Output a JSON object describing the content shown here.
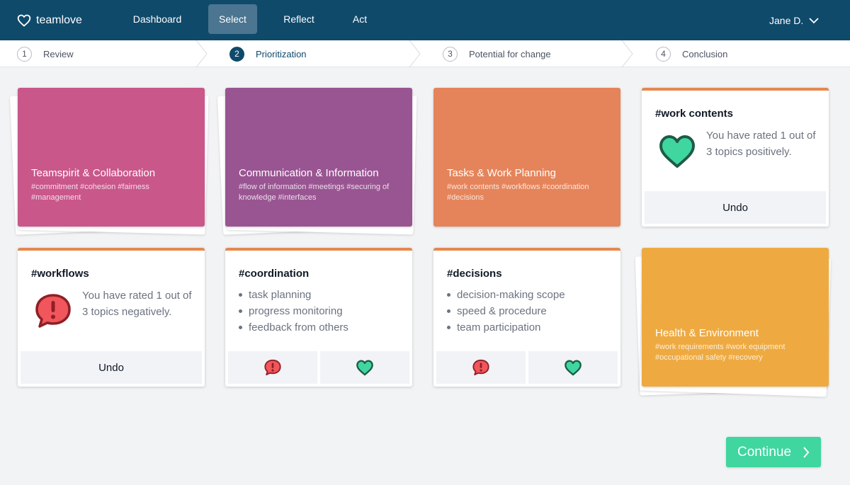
{
  "app": {
    "name": "teamlove"
  },
  "nav": {
    "items": [
      "Dashboard",
      "Select",
      "Reflect",
      "Act"
    ],
    "active": "Select"
  },
  "user": {
    "name": "Jane D."
  },
  "stepper": {
    "steps": [
      {
        "num": "1",
        "label": "Review"
      },
      {
        "num": "2",
        "label": "Prioritization"
      },
      {
        "num": "3",
        "label": "Potential for change"
      },
      {
        "num": "4",
        "label": "Conclusion"
      }
    ],
    "active": 2
  },
  "cards": {
    "teamspirit": {
      "title": "Teamspirit & Collaboration",
      "tags": "#commitment #cohesion #fairness #management",
      "color": "#c9578a"
    },
    "communication": {
      "title": "Communication & Information",
      "tags": "#flow of information #meetings #securing of knowledge #interfaces",
      "color": "#995592"
    },
    "tasks": {
      "title": "Tasks & Work Planning",
      "tags": "#work contents #workflows #coordination #decisions",
      "color": "#e5845a"
    },
    "work_contents": {
      "title": "#work contents",
      "message": "You have rated 1 out of 3 topics positively.",
      "undo": "Undo"
    },
    "workflows": {
      "title": "#workflows",
      "message": "You have rated 1 out of 3 topics negatively.",
      "undo": "Undo"
    },
    "coordination": {
      "title": "#coordination",
      "items": [
        "task planning",
        "progress monitoring",
        "feedback from others"
      ]
    },
    "decisions": {
      "title": "#decisions",
      "items": [
        "decision-making scope",
        "speed & procedure",
        "team participation"
      ]
    },
    "health": {
      "title": "Health & Environment",
      "tags": "#work requirements #work equipment #occupational safety #recovery",
      "color": "#eeaa41"
    }
  },
  "continue_label": "Continue",
  "colors": {
    "nav": "#0f4a6b",
    "accent": "#3fd6a0",
    "alert": "#e0434b",
    "heart": "#3fd6a0"
  }
}
